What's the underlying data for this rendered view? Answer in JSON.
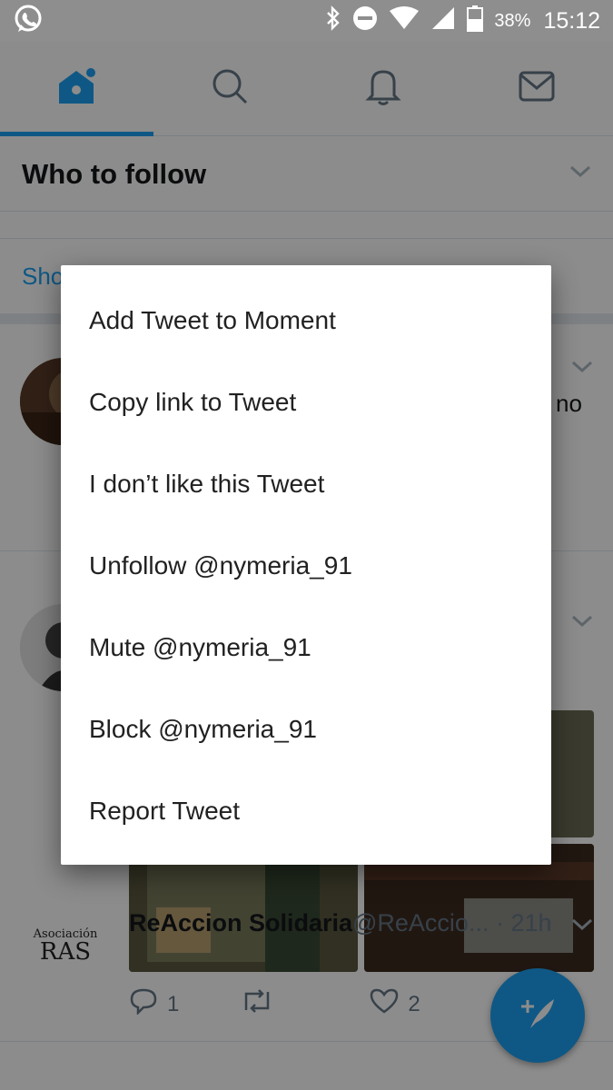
{
  "status_bar": {
    "battery_percent": "38%",
    "time": "15:12",
    "icons": [
      "whatsapp-icon",
      "bluetooth-icon",
      "do-not-disturb-icon",
      "wifi-icon",
      "signal-icon",
      "battery-icon"
    ]
  },
  "tabs": [
    {
      "name": "home-icon",
      "active": true
    },
    {
      "name": "search-icon",
      "active": false
    },
    {
      "name": "bell-icon",
      "active": false
    },
    {
      "name": "mail-icon",
      "active": false
    }
  ],
  "feed": {
    "who_to_follow_title": "Who to follow",
    "show_more_partial": "Sho",
    "tweet1_trailing_text": "no",
    "tweet2": {
      "replies": "1",
      "likes": "2"
    },
    "tweet3": {
      "name": "ReAccion Solidaria",
      "handle_time": "@ReAccio... · 21h",
      "logo_text_top": "Asociación",
      "logo_text_bottom": "RAS"
    }
  },
  "menu": {
    "items": [
      "Add Tweet to Moment",
      "Copy link to Tweet",
      "I don’t like this Tweet",
      "Unfollow @nymeria_91",
      "Mute @nymeria_91",
      "Block @nymeria_91",
      "Report Tweet"
    ]
  },
  "colors": {
    "accent": "#1da1f2",
    "text": "#14171a",
    "muted": "#657786",
    "scrim": "rgba(0,0,0,0.45)"
  }
}
